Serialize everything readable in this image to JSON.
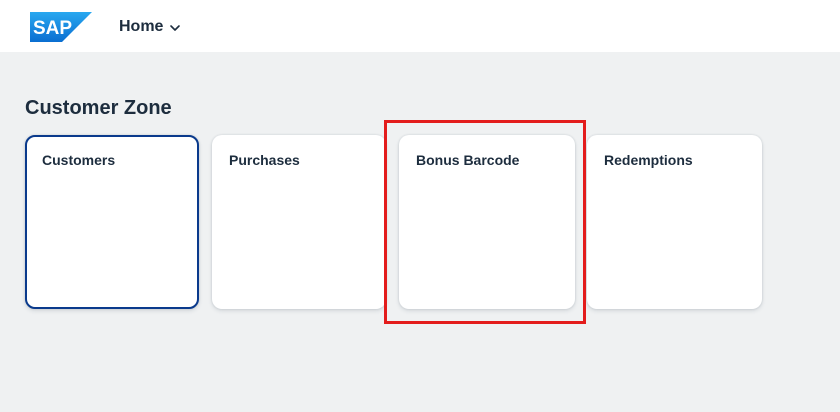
{
  "shellbar": {
    "logo_text": "SAP",
    "home_label": "Home",
    "home_icon": "chevron-down-icon",
    "brand_color": "#1f8cd8"
  },
  "section": {
    "title": "Customer Zone"
  },
  "tiles": [
    {
      "title": "Customers",
      "focused": true
    },
    {
      "title": "Purchases",
      "focused": false
    },
    {
      "title": "Bonus Barcode",
      "focused": false,
      "highlighted": true
    },
    {
      "title": "Redemptions",
      "focused": false
    }
  ],
  "colors": {
    "background": "#eff1f2",
    "text": "#1d2d3e",
    "focus_border": "#0a3a8c",
    "highlight": "#e31c1c"
  }
}
